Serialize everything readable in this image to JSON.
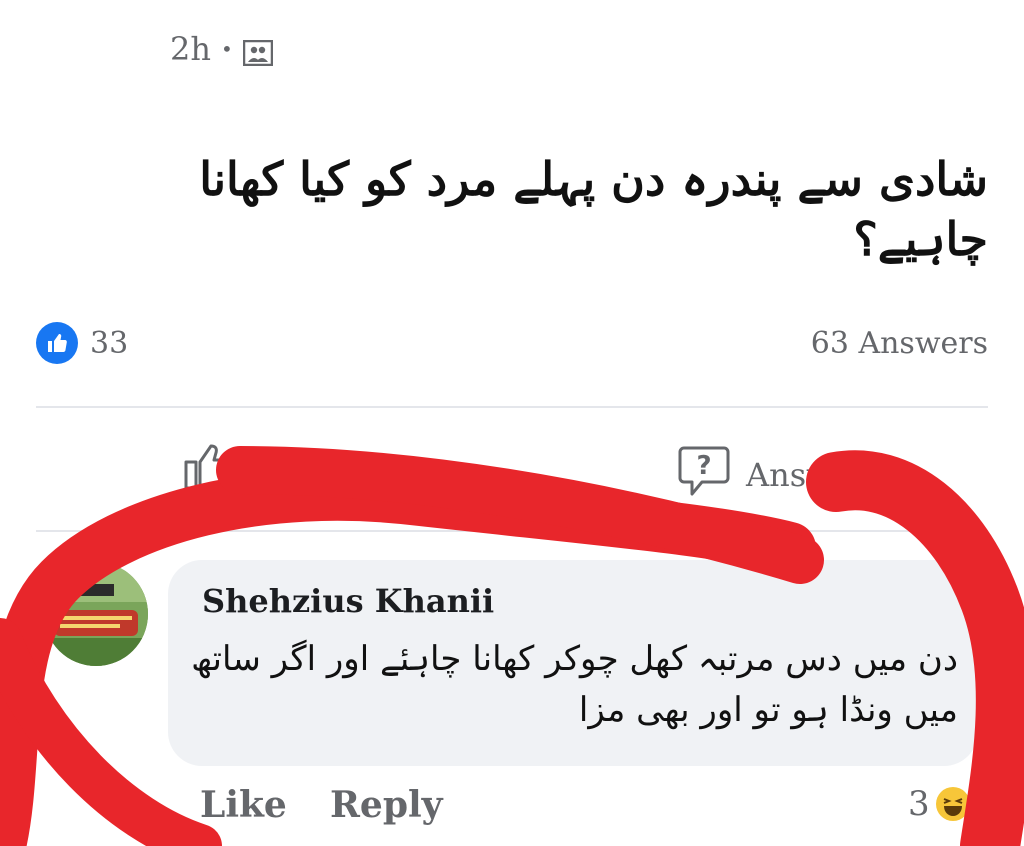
{
  "post": {
    "time": "2h",
    "separator": "•",
    "privacy_icon": "photo-icon",
    "question": "شادی سے پندرہ دن پہلے مرد کو کیا کھانا چاہیے؟"
  },
  "stats": {
    "like_count": "33",
    "answers": "63 Answers"
  },
  "actions": {
    "like_label": "Like",
    "answer_label": "Answ"
  },
  "comment": {
    "author": "Shehzius Khanii",
    "text": "دن میں دس مرتبہ کھل چوکر کھانا چاہئے اور اگر ساتھ میں ونڈا ہو تو اور بھی مزا",
    "like_label": "Like",
    "reply_label": "Reply",
    "reaction_count": "3",
    "reaction_icon": "laughing-emoji-icon"
  },
  "colors": {
    "like_blue": "#1877f2",
    "muted_text": "#65676b",
    "bubble_bg": "#f0f2f5",
    "marker_red": "#e8262b"
  }
}
